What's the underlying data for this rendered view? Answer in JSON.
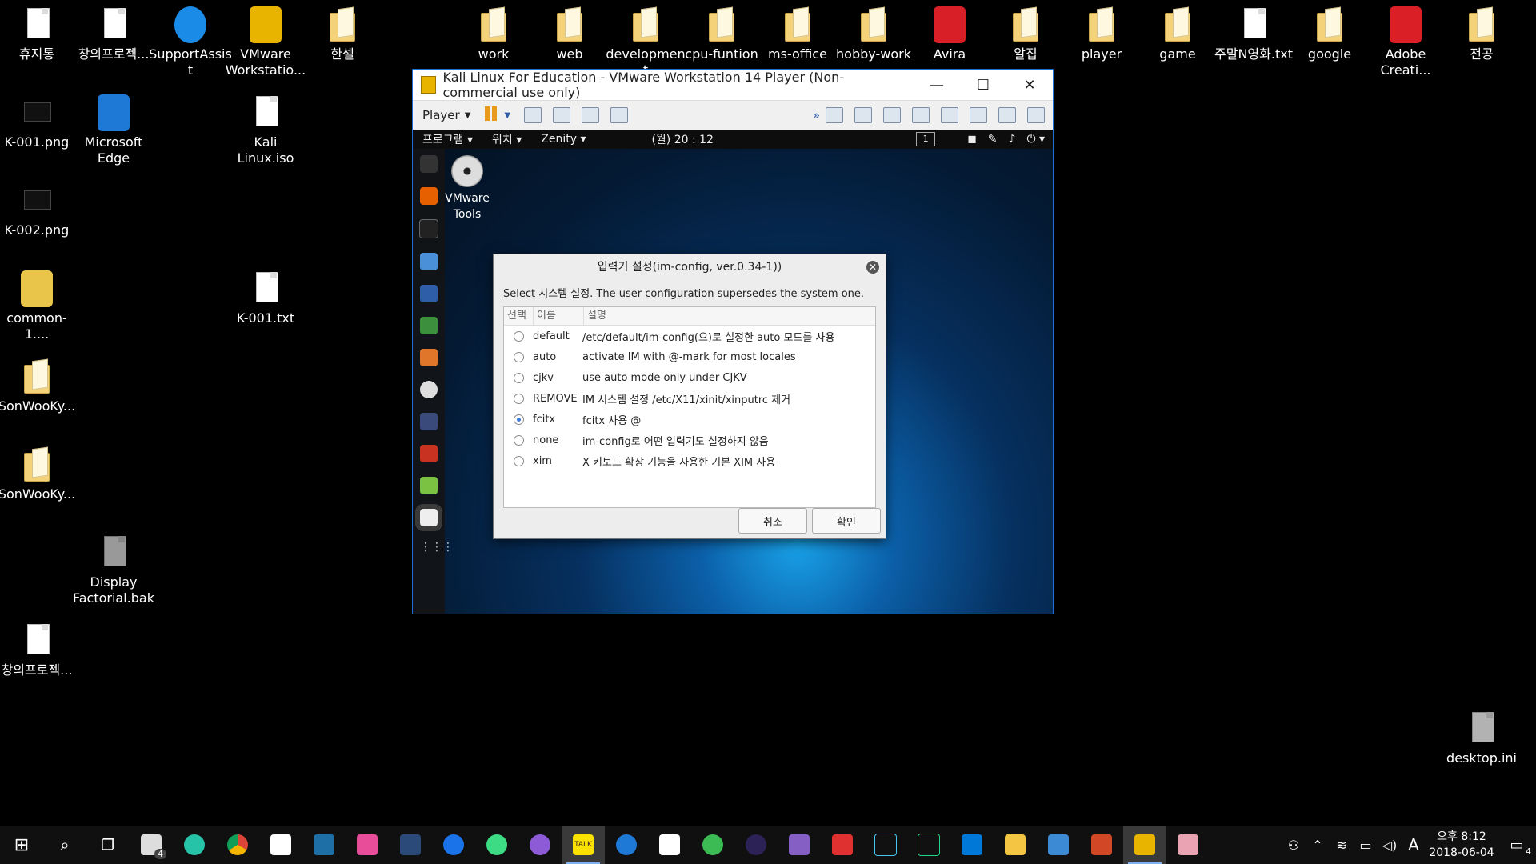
{
  "desktop": {
    "icons_left": [
      {
        "label": "휴지통",
        "icon": "recycle-bin-icon"
      },
      {
        "label": "창의프로젝...",
        "icon": "document-icon"
      },
      {
        "label": "SupportAssist",
        "icon": "support-assist-icon"
      },
      {
        "label": "VMware Workstatio...",
        "icon": "vmware-icon"
      },
      {
        "label": "한셀",
        "icon": "hancell-folder-icon"
      },
      {
        "label": "K-001.png",
        "icon": "image-file-icon"
      },
      {
        "label": "Microsoft Edge",
        "icon": "edge-icon"
      },
      {
        "label": "Kali Linux.iso",
        "icon": "disc-image-icon"
      },
      {
        "label": "K-002.png",
        "icon": "image-file-icon"
      },
      {
        "label": "common-1....",
        "icon": "jar-file-icon"
      },
      {
        "label": "K-001.txt",
        "icon": "text-file-icon"
      },
      {
        "label": "SonWooKy...",
        "icon": "folder-icon"
      },
      {
        "label": "SonWooKy...",
        "icon": "folder-icon"
      },
      {
        "label": "Display Factorial.bak",
        "icon": "backup-file-icon"
      },
      {
        "label": "창의프로젝...",
        "icon": "archive-file-icon"
      }
    ],
    "icons_top": [
      {
        "label": "work"
      },
      {
        "label": "web"
      },
      {
        "label": "development"
      },
      {
        "label": "cpu-funtion"
      },
      {
        "label": "ms-office"
      },
      {
        "label": "hobby-work"
      },
      {
        "label": "Avira"
      },
      {
        "label": "알집"
      },
      {
        "label": "player"
      },
      {
        "label": "game"
      },
      {
        "label": "주말N영화.txt"
      },
      {
        "label": "google"
      },
      {
        "label": "Adobe Creati..."
      },
      {
        "label": "전공"
      }
    ],
    "icon_right": {
      "label": "desktop.ini"
    }
  },
  "vmware": {
    "title": "Kali Linux For Education - VMware Workstation 14 Player (Non-commercial use only)",
    "player_menu": "Player",
    "window_controls": {
      "minimize": "—",
      "maximize": "☐",
      "close": "✕"
    }
  },
  "kali": {
    "panel": {
      "apps": "프로그램 ▾",
      "places": "위치 ▾",
      "app_name": "Zenity ▾",
      "clock": "(월) 20 : 12",
      "workspace": "1"
    },
    "vmtools_label": "VMware Tools"
  },
  "dialog": {
    "title": "입력기 설정(im-config, ver.0.34-1))",
    "message": "Select 시스템 설정. The user configuration supersedes the system one.",
    "columns": [
      "선택",
      "이름",
      "설명"
    ],
    "rows": [
      {
        "name": "default",
        "desc": "/etc/default/im-config(으)로 설정한 auto 모드를 사용",
        "selected": false
      },
      {
        "name": "auto",
        "desc": "activate IM with @-mark for most locales",
        "selected": false
      },
      {
        "name": "cjkv",
        "desc": "use auto mode only under CJKV",
        "selected": false
      },
      {
        "name": "REMOVE",
        "desc": "IM 시스템 설정 /etc/X11/xinit/xinputrc 제거",
        "selected": false
      },
      {
        "name": "fcitx",
        "desc": "fcitx 사용 @",
        "selected": true
      },
      {
        "name": "none",
        "desc": "im-config로 어떤 입력기도 설정하지 않음",
        "selected": false
      },
      {
        "name": "xim",
        "desc": "X 키보드 확장 기능을 사용한 기본 XIM 사용",
        "selected": false
      }
    ],
    "cancel": "취소",
    "ok": "확인"
  },
  "taskbar": {
    "mail_badge": "4",
    "ime": "A",
    "time": "오후 8:12",
    "date": "2018-06-04",
    "notif_badge": "4"
  },
  "colors": {
    "accent": "#1e6fd0",
    "radio_on": "#3b7ad8"
  }
}
